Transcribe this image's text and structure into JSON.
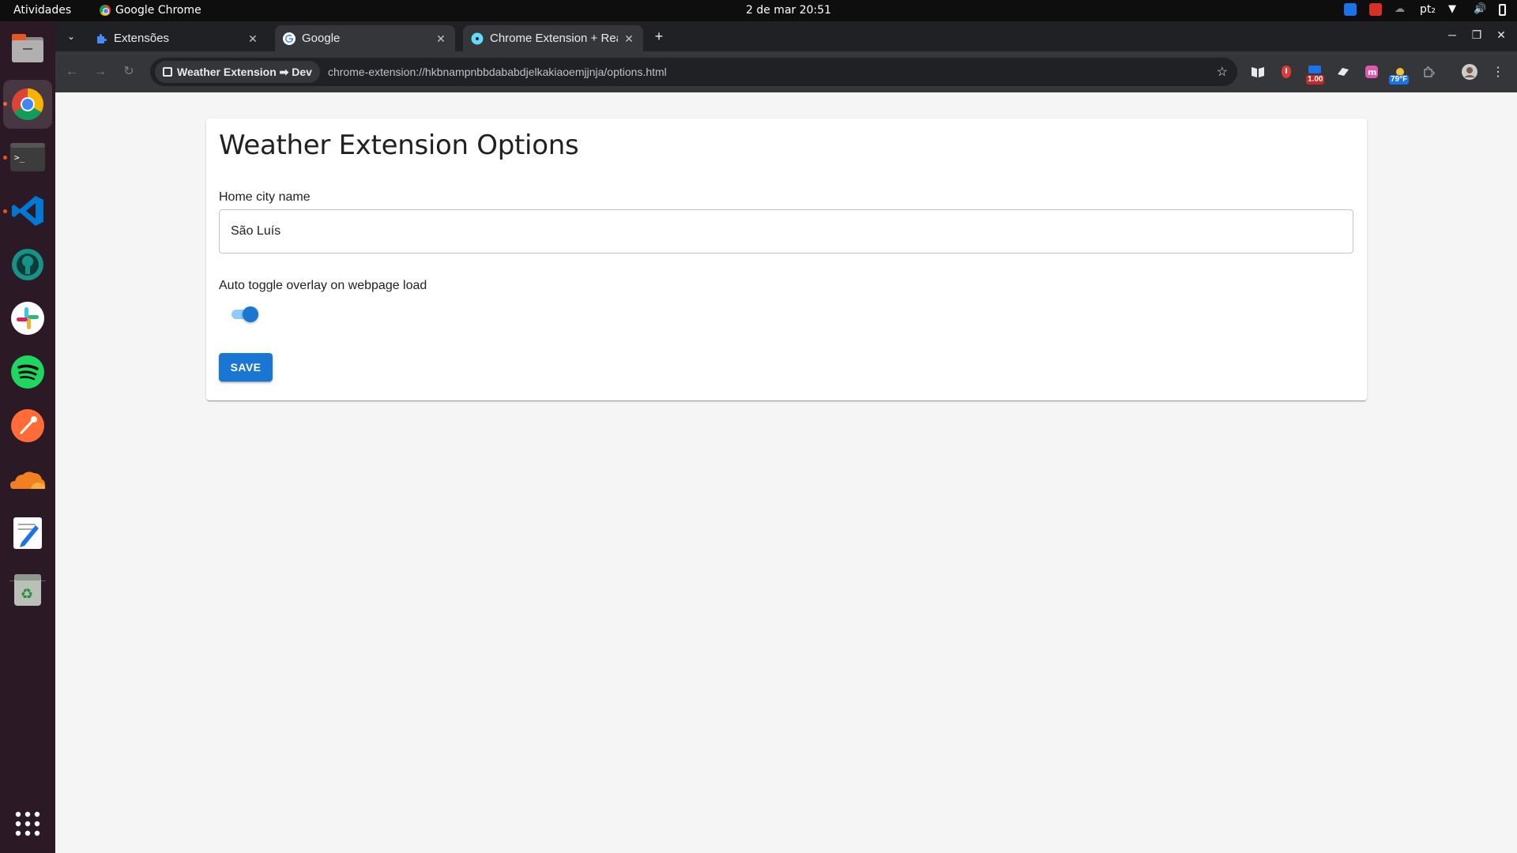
{
  "topbar": {
    "activities": "Atividades",
    "app_name": "Google Chrome",
    "clock": "2 de mar  20:51",
    "keyboard_layout": "pt₂"
  },
  "dock": {
    "items": [
      "files-icon",
      "chrome-icon",
      "terminal-icon",
      "vscode-icon",
      "gitkraken-icon",
      "slack-icon",
      "spotify-icon",
      "postman-icon",
      "cloudflare-icon",
      "text-editor-icon",
      "trash-icon",
      "app-grid-icon"
    ]
  },
  "tabs": [
    {
      "title": "Extensões",
      "favicon": "puzzle-icon"
    },
    {
      "title": "Google",
      "favicon": "google-icon"
    },
    {
      "title": "Chrome Extension + Rea",
      "favicon": "react-icon"
    }
  ],
  "omnibox": {
    "chip": "Weather Extension ➡ Dev",
    "url": "chrome-extension://hkbnampnbbdababdjelkakiaoemjjnja/options.html"
  },
  "extensions": {
    "badge_price": "1.00",
    "badge_weather": "79°F"
  },
  "options": {
    "title": "Weather Extension Options",
    "home_city_label": "Home city name",
    "home_city_value": "São Luís",
    "overlay_label": "Auto toggle overlay on webpage load",
    "overlay_enabled": true,
    "save_label": "SAVE"
  },
  "colors": {
    "primary": "#1976d2",
    "switch_track": "#90caf9",
    "page_bg": "#f5f5f5",
    "dock_bg": "#2b1a26",
    "topbar_bg": "#0e0e0e"
  }
}
